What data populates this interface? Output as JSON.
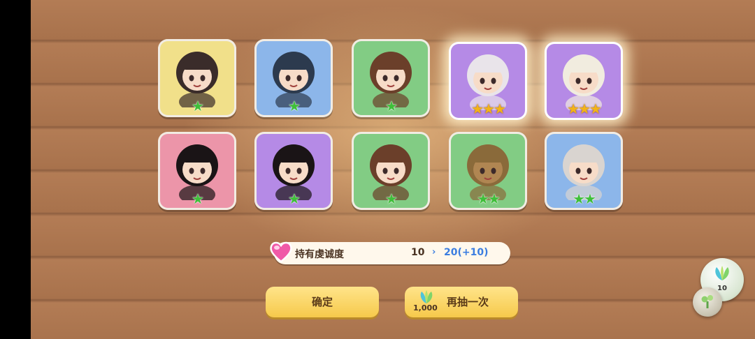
{
  "cards": [
    {
      "name": "card-girl-wolf-ears",
      "frame": "yellow",
      "rarity": "green",
      "stars": 1,
      "hair": "#3a2c2a",
      "skin": "#f7dcc8"
    },
    {
      "name": "card-girl-headband-blue",
      "frame": "blue",
      "rarity": "green",
      "stars": 1,
      "hair": "#2c3a4e",
      "skin": "#f7dcc8"
    },
    {
      "name": "card-girl-red-headband",
      "frame": "green",
      "rarity": "green",
      "stars": 1,
      "hair": "#6b3f2a",
      "skin": "#f7dcc8"
    },
    {
      "name": "card-girl-white-hair-purple",
      "frame": "purple",
      "rarity": "gold",
      "stars": 3,
      "hair": "#e9e4ea",
      "skin": "#f7dcc8",
      "glow": true
    },
    {
      "name": "card-girl-horns-cream",
      "frame": "purple",
      "rarity": "gold",
      "stars": 3,
      "hair": "#f1ecdf",
      "skin": "#f7dcc8",
      "glow": true
    },
    {
      "name": "card-girl-skull-pink",
      "frame": "pink",
      "rarity": "green",
      "stars": 1,
      "hair": "#1a1416",
      "skin": "#f7dcc8"
    },
    {
      "name": "card-girl-skull-purple",
      "frame": "purple",
      "rarity": "green",
      "stars": 1,
      "hair": "#1a1416",
      "skin": "#f7dcc8"
    },
    {
      "name": "card-girl-red-headband-2",
      "frame": "green",
      "rarity": "green",
      "stars": 1,
      "hair": "#6b3f2a",
      "skin": "#f7dcc8"
    },
    {
      "name": "card-tree-golem",
      "frame": "green",
      "rarity": "green",
      "stars": 2,
      "hair": "#8a6a3a",
      "skin": "#b08652"
    },
    {
      "name": "card-girl-grey-horns",
      "frame": "blue",
      "rarity": "green",
      "stars": 2,
      "hair": "#d9d4d0",
      "skin": "#f7dcc8"
    }
  ],
  "affinity": {
    "label": "持有虔诚度",
    "current": "10",
    "arrow": "›",
    "next": "20(+10)"
  },
  "buttons": {
    "confirm": "确定",
    "draw_again": "再抽一次",
    "draw_cost": "1,000"
  },
  "side": {
    "leaf_count": "10"
  },
  "colors": {
    "yellow": "#f1e08a",
    "blue": "#8cb6ea",
    "green": "#82cc84",
    "purple": "#b58ae6",
    "pink": "#ec95a9",
    "star_green": "#3fbf3a",
    "star_gold": "#f3b317",
    "accent_blue": "#3b7de0"
  },
  "icons": {
    "card_star_green": "★",
    "card_star_gold": "★",
    "heart": "heart-icon",
    "leaf": "leaf-icon",
    "sprout": "sprout-icon"
  }
}
